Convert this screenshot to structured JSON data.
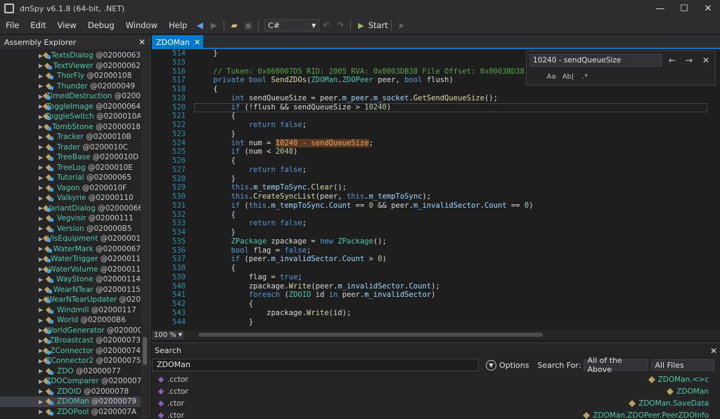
{
  "window": {
    "title": "dnSpy v6.1.8 (64-bit, .NET)",
    "min": "—",
    "max": "☐",
    "close": "✕"
  },
  "menu": [
    "File",
    "Edit",
    "View",
    "Debug",
    "Window",
    "Help"
  ],
  "toolbar": {
    "language": "C#",
    "start_label": "Start"
  },
  "assembly_explorer": {
    "title": "Assembly Explorer",
    "items": [
      {
        "name": "TextsDialog",
        "token": "@02000063"
      },
      {
        "name": "TextViewer",
        "token": "@02000062"
      },
      {
        "name": "ThorFly",
        "token": "@02000108"
      },
      {
        "name": "Thunder",
        "token": "@02000049"
      },
      {
        "name": "TimedDestruction",
        "token": "@0200"
      },
      {
        "name": "ToggleImage",
        "token": "@02000064"
      },
      {
        "name": "ToggleSwitch",
        "token": "@0200010A"
      },
      {
        "name": "TombStone",
        "token": "@02000018"
      },
      {
        "name": "Tracker",
        "token": "@0200010B"
      },
      {
        "name": "Trader",
        "token": "@0200010C"
      },
      {
        "name": "TreeBase",
        "token": "@0200010D"
      },
      {
        "name": "TreeLog",
        "token": "@0200010E"
      },
      {
        "name": "Tutorial",
        "token": "@02000065"
      },
      {
        "name": "Vagon",
        "token": "@0200010F"
      },
      {
        "name": "Valkyrie",
        "token": "@02000110"
      },
      {
        "name": "VariantDialog",
        "token": "@02000066"
      },
      {
        "name": "Vegvisir",
        "token": "@02000111"
      },
      {
        "name": "Version",
        "token": "@020000B5"
      },
      {
        "name": "VisEquipment",
        "token": "@0200001"
      },
      {
        "name": "WaterMark",
        "token": "@02000067"
      },
      {
        "name": "WaterTrigger",
        "token": "@0200011"
      },
      {
        "name": "WaterVolume",
        "token": "@0200011"
      },
      {
        "name": "WayStone",
        "token": "@02000114"
      },
      {
        "name": "WearNTear",
        "token": "@02000115"
      },
      {
        "name": "WearNTearUpdater",
        "token": "@020"
      },
      {
        "name": "Windmill",
        "token": "@02000117"
      },
      {
        "name": "World",
        "token": "@020000B6"
      },
      {
        "name": "WorldGenerator",
        "token": "@020000"
      },
      {
        "name": "ZBroastcast",
        "token": "@02000073"
      },
      {
        "name": "ZConnector",
        "token": "@02000074"
      },
      {
        "name": "ZConnector2",
        "token": "@02000075"
      },
      {
        "name": "ZDO",
        "token": "@02000077"
      },
      {
        "name": "ZDOComparer",
        "token": "@0200007"
      },
      {
        "name": "ZDOID",
        "token": "@02000078"
      },
      {
        "name": "ZDOMan",
        "token": "@02000079"
      },
      {
        "name": "ZDOPool",
        "token": "@0200007A"
      }
    ]
  },
  "document_tab": {
    "label": "ZDOMan"
  },
  "editor": {
    "line_numbers": [
      "514",
      "515",
      "516",
      "517",
      "518",
      "519",
      "520",
      "521",
      "522",
      "523",
      "524",
      "525",
      "526",
      "527",
      "528",
      "529",
      "530",
      "531",
      "532",
      "533",
      "534",
      "535",
      "536",
      "537",
      "538",
      "539",
      "540",
      "541",
      "542",
      "543",
      "544"
    ],
    "zoom": "100 %"
  },
  "find": {
    "query": "10240 - sendQueueSize"
  },
  "search": {
    "title": "Search",
    "query": "ZDOMan",
    "options_label": "Options",
    "search_for_label": "Search For:",
    "search_for_value": "All of the Above",
    "scope_value": "All Files",
    "results": [
      {
        "left": ".cctor",
        "right": "ZDOMan.<>c"
      },
      {
        "left": ".cctor",
        "right": "ZDOMan"
      },
      {
        "left": ".ctor",
        "right": "ZDOMan.SaveData"
      },
      {
        "left": ".ctor",
        "right": "ZDOMan.ZDOPeer.PeerZDOInfo"
      }
    ]
  }
}
